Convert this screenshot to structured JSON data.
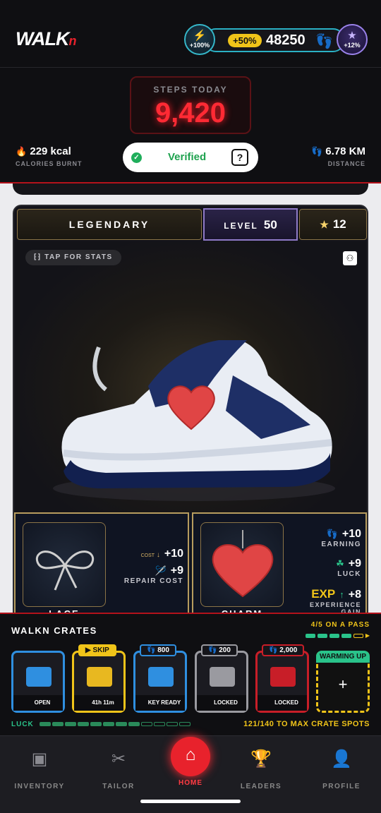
{
  "header": {
    "logo_main": "WALK",
    "logo_sub": "n",
    "boost_left": "+100%",
    "boost_pct": "+50%",
    "balance": "48250",
    "boost_right": "+12%"
  },
  "stats": {
    "steps_label": "STEPS TODAY",
    "steps_value": "9,420",
    "calories_value": "229 kcal",
    "calories_label": "CALORIES BURNT",
    "distance_value": "6.78 KM",
    "distance_label": "DISTANCE",
    "verified_label": "Verified",
    "help": "?"
  },
  "sneaker": {
    "tier": "LEGENDARY",
    "level_label": "LEVEL",
    "level": "50",
    "stars": "12",
    "tap_for_stats": "TAP FOR STATS"
  },
  "parts": [
    {
      "title": "LACE",
      "stat1_label": "COST",
      "stat1_value": "+10",
      "stat2_value": "+9",
      "stat2_label": "REPAIR COST"
    },
    {
      "title": "CHARM",
      "stat1_value": "+10",
      "stat1_label": "EARNING",
      "stat2_value": "+9",
      "stat2_label": "LUCK",
      "stat3_prefix": "EXP",
      "stat3_value": "+8",
      "stat3_label": "EXPERIENCE GAIN"
    }
  ],
  "crates": {
    "title": "WALKN CRATES",
    "pass": "4/5 ON A PASS",
    "items": [
      {
        "footer": "OPEN",
        "tag": ""
      },
      {
        "footer": "41h 11m",
        "tag": "▶ SKIP"
      },
      {
        "footer": "KEY READY",
        "tag": "800"
      },
      {
        "footer": "LOCKED",
        "tag": "200"
      },
      {
        "footer": "LOCKED",
        "tag": "2,000"
      }
    ],
    "warming": "WARMING UP",
    "plus": "+",
    "luck_label": "LUCK",
    "max_spots": "121/140 TO MAX CRATE SPOTS"
  },
  "nav": {
    "inventory": "INVENTORY",
    "tailor": "TAILOR",
    "home": "HOME",
    "leaders": "LEADERS",
    "profile": "PROFILE"
  },
  "colors": {
    "accent": "#e8222c",
    "teal": "#2ab0c4",
    "gold": "#f0c419",
    "green": "#2ac38a"
  }
}
